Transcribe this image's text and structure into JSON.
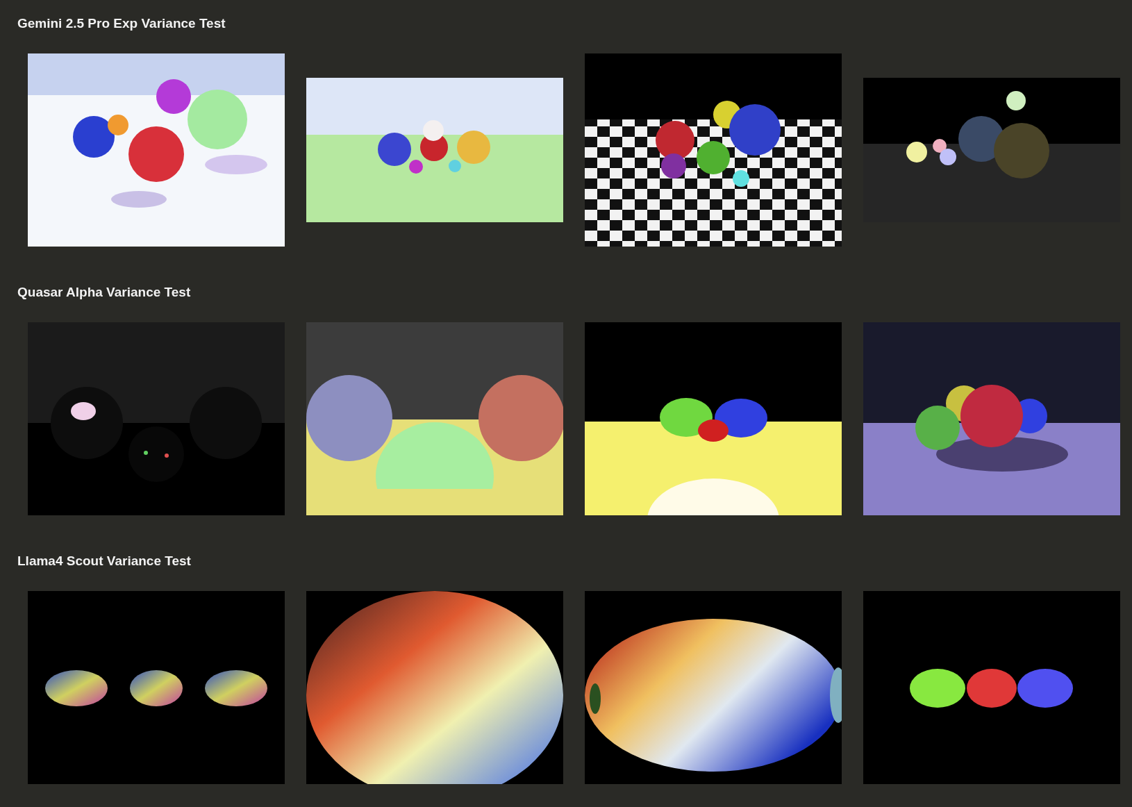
{
  "sections": [
    {
      "title": "Gemini 2.5 Pro Exp Variance Test"
    },
    {
      "title": "Quasar Alpha Variance Test"
    },
    {
      "title": "Llama4 Scout Variance Test"
    }
  ]
}
